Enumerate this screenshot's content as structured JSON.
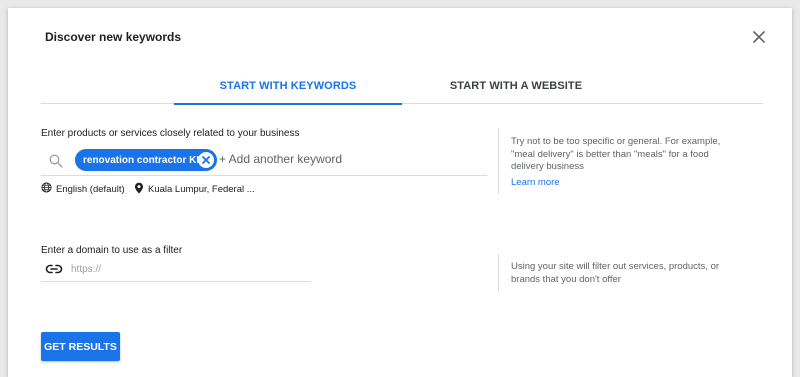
{
  "dialog": {
    "title": "Discover new keywords"
  },
  "tabs": [
    {
      "label": "START WITH KEYWORDS",
      "active": true
    },
    {
      "label": "START WITH A WEBSITE",
      "active": false
    }
  ],
  "keywords": {
    "label": "Enter products or services closely related to your business",
    "chip": "renovation contractor KL",
    "add_placeholder": "+ Add another keyword",
    "language": "English (default)",
    "location": "Kuala Lumpur, Federal ...",
    "help_text": "Try not to be too specific or general. For example, \"meal delivery\" is better than \"meals\" for a food delivery business",
    "learn_more": "Learn more"
  },
  "domain": {
    "label": "Enter a domain to use as a filter",
    "placeholder": "https://",
    "value": "",
    "help_text": "Using your site will filter out services, products, or brands that you don't offer"
  },
  "actions": {
    "submit_label": "GET RESULTS"
  },
  "colors": {
    "accent": "#1a73e8",
    "text": "#202124",
    "muted": "#5f6368",
    "divider": "#dadce0"
  },
  "icons": [
    "close-icon",
    "search-icon",
    "chip-remove-icon",
    "globe-icon",
    "location-pin-icon",
    "link-icon"
  ]
}
